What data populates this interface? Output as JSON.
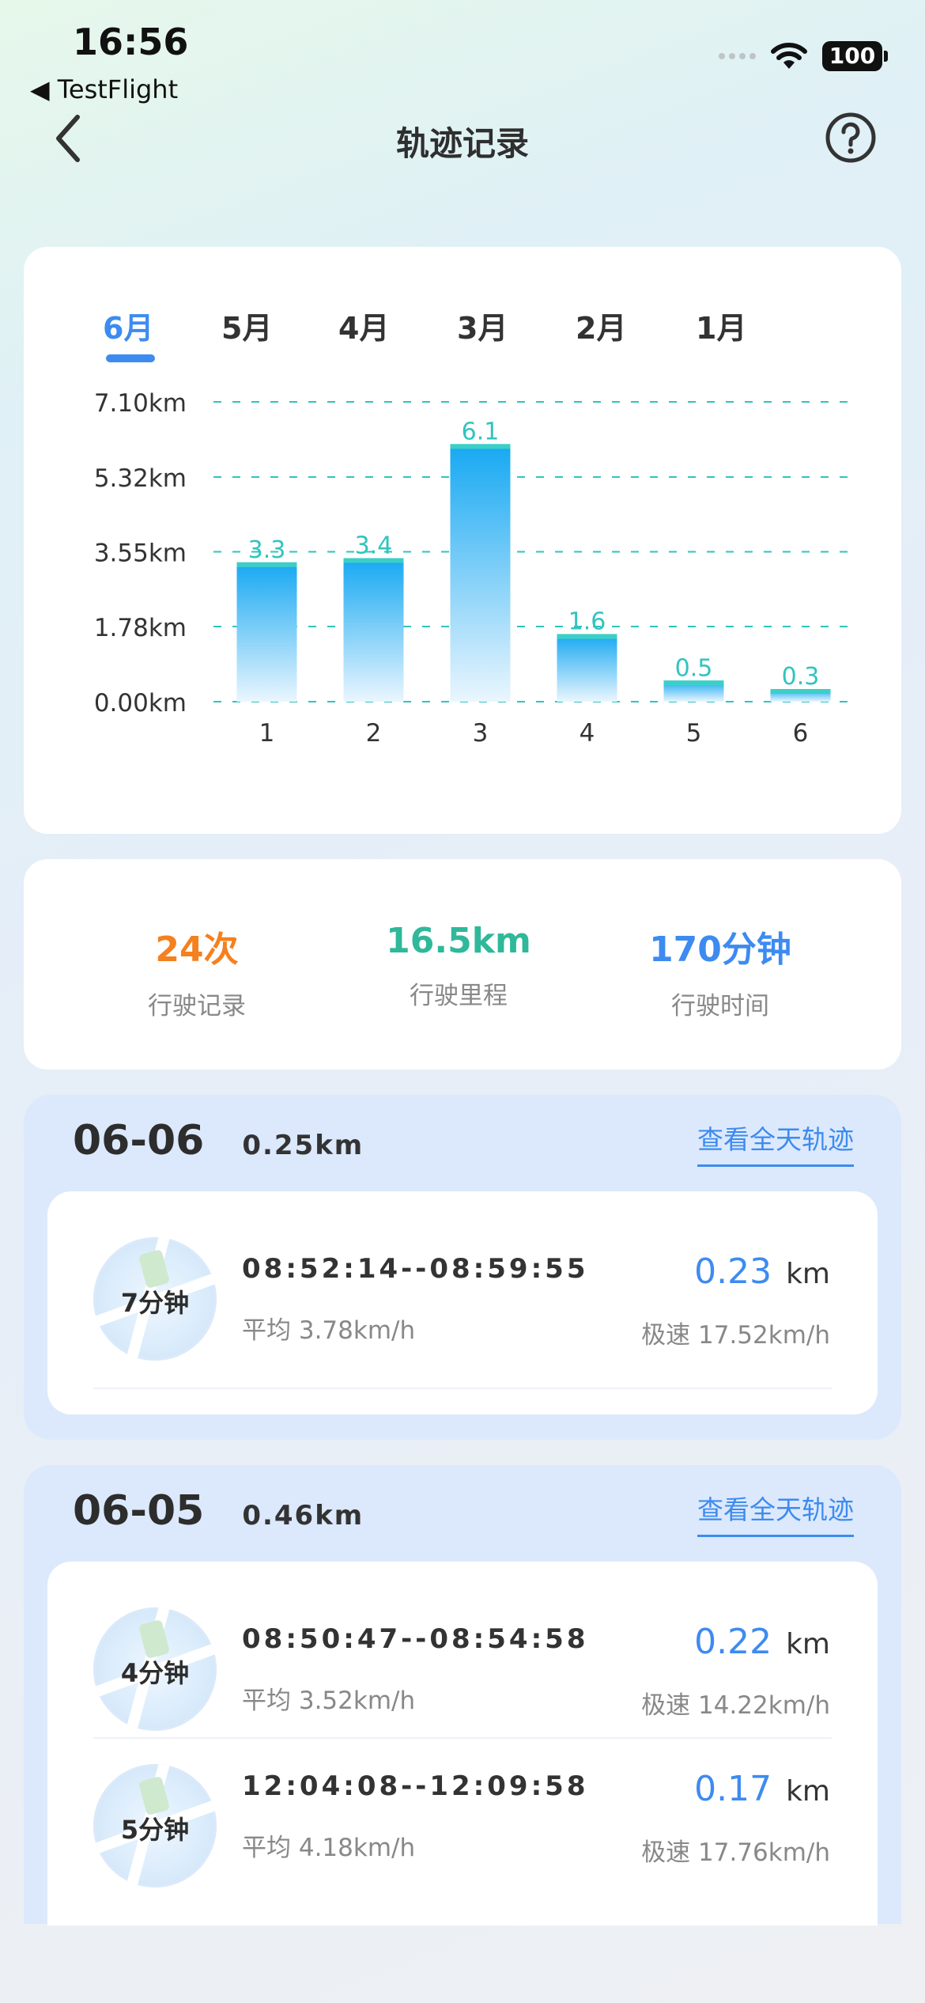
{
  "status": {
    "time": "16:56",
    "back_app": "◀ TestFlight",
    "battery": "100"
  },
  "nav": {
    "title": "轨迹记录",
    "back_icon": "chevron-left-icon",
    "help_icon": "question-circle-icon"
  },
  "tabs": [
    "6月",
    "5月",
    "4月",
    "3月",
    "2月",
    "1月"
  ],
  "active_tab": 0,
  "chart_data": {
    "type": "bar",
    "categories": [
      "1",
      "2",
      "3",
      "4",
      "5",
      "6"
    ],
    "values": [
      3.3,
      3.4,
      6.1,
      1.6,
      0.5,
      0.3
    ],
    "data_labels": [
      "3.3",
      "3.4",
      "6.1",
      "1.6",
      "0.5",
      "0.3"
    ],
    "y_ticks": [
      "0.00km",
      "1.78km",
      "3.55km",
      "5.32km",
      "7.10km"
    ],
    "y_tick_values": [
      0,
      1.78,
      3.55,
      5.32,
      7.1
    ],
    "ylim": [
      0,
      7.1
    ],
    "grid": true,
    "colors": {
      "bar_top": "#16a8f2",
      "bar_bottom": "#eaf6fe",
      "cap": "#3ccfc6",
      "label": "#2fc4bf",
      "grid": "#2fc4bf"
    }
  },
  "stats": [
    {
      "value": "24次",
      "label": "行驶记录",
      "color": "#f5801f"
    },
    {
      "value": "16.5km",
      "label": "行驶里程",
      "color": "#2fb89a"
    },
    {
      "value": "170分钟",
      "label": "行驶时间",
      "color": "#3d8bf0"
    }
  ],
  "days": [
    {
      "date": "06-06",
      "distance": "0.25km",
      "link": "查看全天轨迹",
      "trips": [
        {
          "duration": "7分钟",
          "time": "08:52:14--08:59:55",
          "avg": "平均 3.78km/h",
          "km": "0.23",
          "unit": "km",
          "max": "极速 17.52km/h"
        }
      ]
    },
    {
      "date": "06-05",
      "distance": "0.46km",
      "link": "查看全天轨迹",
      "trips": [
        {
          "duration": "4分钟",
          "time": "08:50:47--08:54:58",
          "avg": "平均 3.52km/h",
          "km": "0.22",
          "unit": "km",
          "max": "极速 14.22km/h"
        },
        {
          "duration": "5分钟",
          "time": "12:04:08--12:09:58",
          "avg": "平均 4.18km/h",
          "km": "0.17",
          "unit": "km",
          "max": "极速 17.76km/h"
        }
      ]
    }
  ]
}
